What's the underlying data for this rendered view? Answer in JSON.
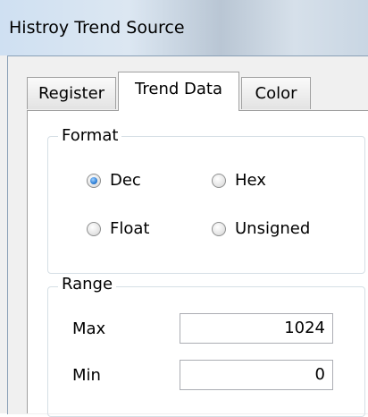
{
  "window": {
    "title": "Histroy Trend Source"
  },
  "tabs": [
    {
      "label": "Register",
      "active": false
    },
    {
      "label": "Trend Data",
      "active": true
    },
    {
      "label": "Color",
      "active": false
    }
  ],
  "format": {
    "label": "Format",
    "options": [
      {
        "label": "Dec",
        "checked": true
      },
      {
        "label": "Hex",
        "checked": false
      },
      {
        "label": "Float",
        "checked": false
      },
      {
        "label": "Unsigned",
        "checked": false
      }
    ]
  },
  "range": {
    "label": "Range",
    "max_label": "Max",
    "max_value": "1024",
    "min_label": "Min",
    "min_value": "0"
  }
}
